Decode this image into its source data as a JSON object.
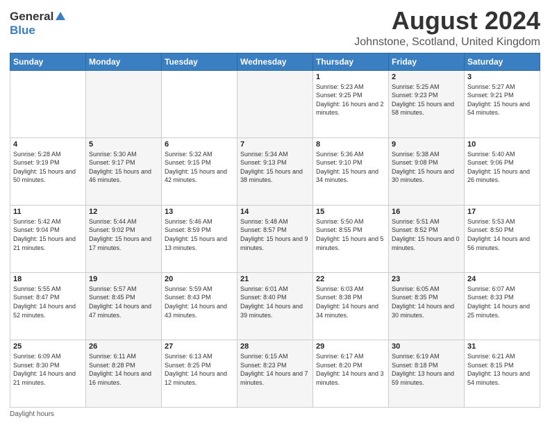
{
  "header": {
    "logo_general": "General",
    "logo_blue": "Blue",
    "main_title": "August 2024",
    "subtitle": "Johnstone, Scotland, United Kingdom"
  },
  "columns": [
    "Sunday",
    "Monday",
    "Tuesday",
    "Wednesday",
    "Thursday",
    "Friday",
    "Saturday"
  ],
  "weeks": [
    [
      {
        "day": "",
        "sunrise": "",
        "sunset": "",
        "daylight": ""
      },
      {
        "day": "",
        "sunrise": "",
        "sunset": "",
        "daylight": ""
      },
      {
        "day": "",
        "sunrise": "",
        "sunset": "",
        "daylight": ""
      },
      {
        "day": "",
        "sunrise": "",
        "sunset": "",
        "daylight": ""
      },
      {
        "day": "1",
        "sunrise": "Sunrise: 5:23 AM",
        "sunset": "Sunset: 9:25 PM",
        "daylight": "Daylight: 16 hours and 2 minutes."
      },
      {
        "day": "2",
        "sunrise": "Sunrise: 5:25 AM",
        "sunset": "Sunset: 9:23 PM",
        "daylight": "Daylight: 15 hours and 58 minutes."
      },
      {
        "day": "3",
        "sunrise": "Sunrise: 5:27 AM",
        "sunset": "Sunset: 9:21 PM",
        "daylight": "Daylight: 15 hours and 54 minutes."
      }
    ],
    [
      {
        "day": "4",
        "sunrise": "Sunrise: 5:28 AM",
        "sunset": "Sunset: 9:19 PM",
        "daylight": "Daylight: 15 hours and 50 minutes."
      },
      {
        "day": "5",
        "sunrise": "Sunrise: 5:30 AM",
        "sunset": "Sunset: 9:17 PM",
        "daylight": "Daylight: 15 hours and 46 minutes."
      },
      {
        "day": "6",
        "sunrise": "Sunrise: 5:32 AM",
        "sunset": "Sunset: 9:15 PM",
        "daylight": "Daylight: 15 hours and 42 minutes."
      },
      {
        "day": "7",
        "sunrise": "Sunrise: 5:34 AM",
        "sunset": "Sunset: 9:13 PM",
        "daylight": "Daylight: 15 hours and 38 minutes."
      },
      {
        "day": "8",
        "sunrise": "Sunrise: 5:36 AM",
        "sunset": "Sunset: 9:10 PM",
        "daylight": "Daylight: 15 hours and 34 minutes."
      },
      {
        "day": "9",
        "sunrise": "Sunrise: 5:38 AM",
        "sunset": "Sunset: 9:08 PM",
        "daylight": "Daylight: 15 hours and 30 minutes."
      },
      {
        "day": "10",
        "sunrise": "Sunrise: 5:40 AM",
        "sunset": "Sunset: 9:06 PM",
        "daylight": "Daylight: 15 hours and 26 minutes."
      }
    ],
    [
      {
        "day": "11",
        "sunrise": "Sunrise: 5:42 AM",
        "sunset": "Sunset: 9:04 PM",
        "daylight": "Daylight: 15 hours and 21 minutes."
      },
      {
        "day": "12",
        "sunrise": "Sunrise: 5:44 AM",
        "sunset": "Sunset: 9:02 PM",
        "daylight": "Daylight: 15 hours and 17 minutes."
      },
      {
        "day": "13",
        "sunrise": "Sunrise: 5:46 AM",
        "sunset": "Sunset: 8:59 PM",
        "daylight": "Daylight: 15 hours and 13 minutes."
      },
      {
        "day": "14",
        "sunrise": "Sunrise: 5:48 AM",
        "sunset": "Sunset: 8:57 PM",
        "daylight": "Daylight: 15 hours and 9 minutes."
      },
      {
        "day": "15",
        "sunrise": "Sunrise: 5:50 AM",
        "sunset": "Sunset: 8:55 PM",
        "daylight": "Daylight: 15 hours and 5 minutes."
      },
      {
        "day": "16",
        "sunrise": "Sunrise: 5:51 AM",
        "sunset": "Sunset: 8:52 PM",
        "daylight": "Daylight: 15 hours and 0 minutes."
      },
      {
        "day": "17",
        "sunrise": "Sunrise: 5:53 AM",
        "sunset": "Sunset: 8:50 PM",
        "daylight": "Daylight: 14 hours and 56 minutes."
      }
    ],
    [
      {
        "day": "18",
        "sunrise": "Sunrise: 5:55 AM",
        "sunset": "Sunset: 8:47 PM",
        "daylight": "Daylight: 14 hours and 52 minutes."
      },
      {
        "day": "19",
        "sunrise": "Sunrise: 5:57 AM",
        "sunset": "Sunset: 8:45 PM",
        "daylight": "Daylight: 14 hours and 47 minutes."
      },
      {
        "day": "20",
        "sunrise": "Sunrise: 5:59 AM",
        "sunset": "Sunset: 8:43 PM",
        "daylight": "Daylight: 14 hours and 43 minutes."
      },
      {
        "day": "21",
        "sunrise": "Sunrise: 6:01 AM",
        "sunset": "Sunset: 8:40 PM",
        "daylight": "Daylight: 14 hours and 39 minutes."
      },
      {
        "day": "22",
        "sunrise": "Sunrise: 6:03 AM",
        "sunset": "Sunset: 8:38 PM",
        "daylight": "Daylight: 14 hours and 34 minutes."
      },
      {
        "day": "23",
        "sunrise": "Sunrise: 6:05 AM",
        "sunset": "Sunset: 8:35 PM",
        "daylight": "Daylight: 14 hours and 30 minutes."
      },
      {
        "day": "24",
        "sunrise": "Sunrise: 6:07 AM",
        "sunset": "Sunset: 8:33 PM",
        "daylight": "Daylight: 14 hours and 25 minutes."
      }
    ],
    [
      {
        "day": "25",
        "sunrise": "Sunrise: 6:09 AM",
        "sunset": "Sunset: 8:30 PM",
        "daylight": "Daylight: 14 hours and 21 minutes."
      },
      {
        "day": "26",
        "sunrise": "Sunrise: 6:11 AM",
        "sunset": "Sunset: 8:28 PM",
        "daylight": "Daylight: 14 hours and 16 minutes."
      },
      {
        "day": "27",
        "sunrise": "Sunrise: 6:13 AM",
        "sunset": "Sunset: 8:25 PM",
        "daylight": "Daylight: 14 hours and 12 minutes."
      },
      {
        "day": "28",
        "sunrise": "Sunrise: 6:15 AM",
        "sunset": "Sunset: 8:23 PM",
        "daylight": "Daylight: 14 hours and 7 minutes."
      },
      {
        "day": "29",
        "sunrise": "Sunrise: 6:17 AM",
        "sunset": "Sunset: 8:20 PM",
        "daylight": "Daylight: 14 hours and 3 minutes."
      },
      {
        "day": "30",
        "sunrise": "Sunrise: 6:19 AM",
        "sunset": "Sunset: 8:18 PM",
        "daylight": "Daylight: 13 hours and 59 minutes."
      },
      {
        "day": "31",
        "sunrise": "Sunrise: 6:21 AM",
        "sunset": "Sunset: 8:15 PM",
        "daylight": "Daylight: 13 hours and 54 minutes."
      }
    ]
  ],
  "footer": {
    "label": "Daylight hours"
  },
  "colors": {
    "header_bg": "#3a7fc1",
    "accent": "#3a7fc1"
  }
}
